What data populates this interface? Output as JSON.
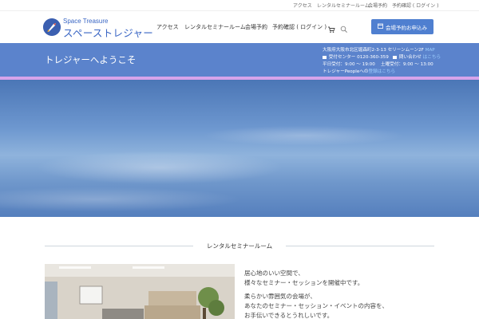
{
  "topbar": {
    "links": [
      "アクセス",
      "レンタルセミナールーム",
      "会場予約",
      "予約確認 ( ログイン )"
    ]
  },
  "header": {
    "logo_sub": "Space Treasure",
    "logo_main": "スペーストレジャー",
    "nav": [
      "アクセス",
      "レンタルセミナールーム",
      "会場予約",
      "予約確認 ( ログイン )"
    ],
    "cta_label": "会場予約お申込み"
  },
  "band": {
    "title": "トレジャーへようこそ",
    "address": "大阪府大阪市北区堀森町2-3-13 セリーンムーン2F",
    "map_link": "MAP",
    "phone_label": "受付センター",
    "phone": "0120-360-359",
    "contact_label": "問い合わせ",
    "contact_link": "はこちら",
    "hours_weekday": "平日受付：9:00 ～ 19:00",
    "hours_saturday": "土曜受付：9:00 ～ 13:00",
    "people_prefix": "トレジャーPeopleへの",
    "people_link": "登録",
    "people_link2": "はこちら"
  },
  "section": {
    "title": "レンタルセミナールーム",
    "lines": [
      "居心地のいい空間で、",
      "様々なセミナー・セッションを開催中です。",
      "柔らかい雰囲気の会場が、",
      "あなたのセミナー・セッション・イベントの内容を、",
      "お手伝いできるとうれしいです。"
    ]
  },
  "colors": {
    "brand": "#3a66c4",
    "band": "#5b83cc",
    "stripe": "#d6a4ea",
    "cta": "#4f7fd0"
  },
  "icons": [
    "rocket-logo-icon",
    "cart-icon",
    "search-icon",
    "calendar-icon",
    "phone-icon",
    "mail-icon"
  ]
}
